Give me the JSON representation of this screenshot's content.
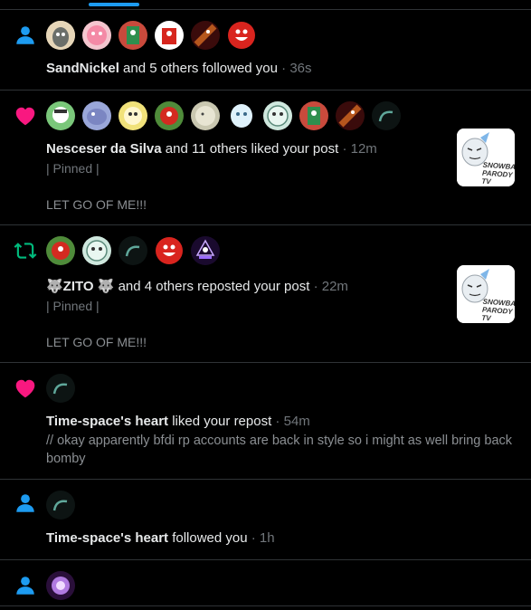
{
  "colors": {
    "accent": "#1d9bf0",
    "like": "#f91880",
    "repost": "#00ba7c",
    "muted": "#71767b"
  },
  "notifications": [
    {
      "kind": "follow-icon",
      "avatars": [
        "avatar-1",
        "avatar-2",
        "avatar-3",
        "avatar-4",
        "avatar-5",
        "avatar-6"
      ],
      "actor": "SandNickel",
      "text": " and 5 others followed you",
      "time": " · 36s"
    },
    {
      "kind": "heart-icon",
      "avatars": [
        "avatar-1",
        "avatar-2",
        "avatar-3",
        "avatar-4",
        "avatar-5",
        "avatar-6",
        "avatar-7",
        "avatar-8",
        "avatar-9",
        "avatar-10"
      ],
      "actor": "Nesceser da Silva",
      "text": " and 11 others liked your post",
      "time": " · 12m",
      "pinned": "| Pinned |",
      "body": "LET GO OF ME!!!",
      "thumb_caption": "SNOWBALL PARODY TV"
    },
    {
      "kind": "repost-icon",
      "avatars": [
        "avatar-1",
        "avatar-2",
        "avatar-3",
        "avatar-4",
        "avatar-5"
      ],
      "actor": "🐺ZITO 🐺",
      "text": " and 4 others reposted your post",
      "time": " · 22m",
      "pinned": "| Pinned |",
      "body": "LET GO OF ME!!!",
      "thumb_caption": "SNOWBALL PARODY TV"
    },
    {
      "kind": "heart-icon",
      "avatars": [
        "avatar-1"
      ],
      "actor": "Time-space's heart",
      "text": " liked your repost",
      "time": " · 54m",
      "body": "// okay apparently bfdi rp accounts are back in style so i might as well bring back bomby"
    },
    {
      "kind": "follow-icon",
      "avatars": [
        "avatar-1"
      ],
      "actor": "Time-space's heart",
      "text": " followed you",
      "time": " · 1h"
    },
    {
      "kind": "follow-icon",
      "avatars": [
        "avatar-1"
      ]
    }
  ]
}
